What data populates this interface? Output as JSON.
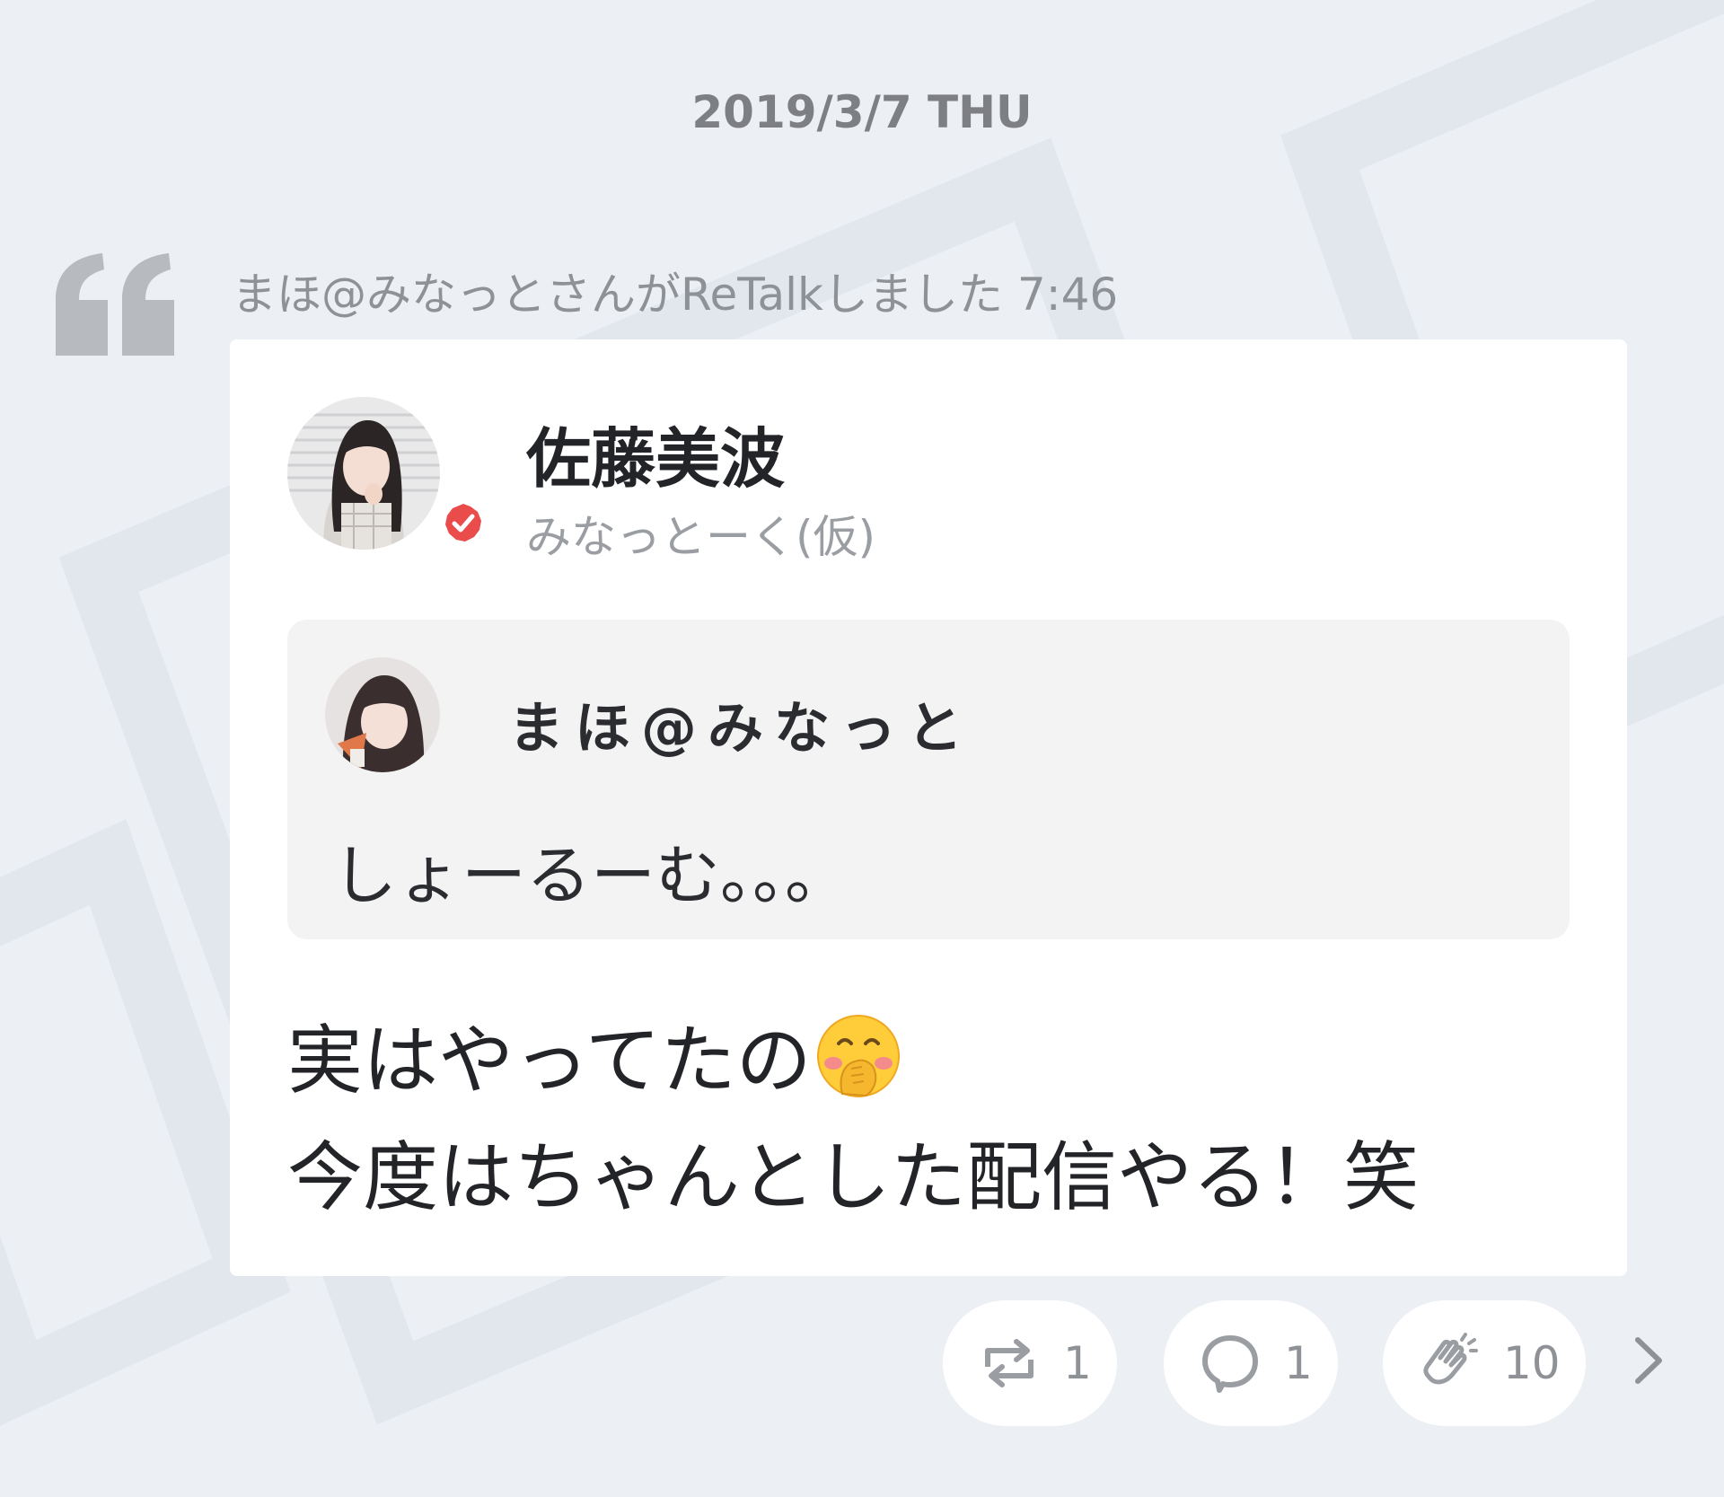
{
  "date_header": "2019/3/7 THU",
  "retalk": {
    "text": "まほ@みなっとさんがReTalkしました",
    "time": "7:46"
  },
  "post": {
    "author": "佐藤美波",
    "community": "みなっとーく(仮)",
    "verified": true,
    "quoted": {
      "author": "まほ@みなっと",
      "text": "しょーるーむ。。。"
    },
    "body_line1": "実はやってたの",
    "body_line1_emoji": "face-with-hand-over-mouth",
    "body_line2": "今度はちゃんとした配信やる！笑"
  },
  "actions": {
    "retalk_count": "1",
    "comment_count": "1",
    "clap_count": "10"
  },
  "colors": {
    "background": "#eceff3",
    "verified_badge": "#ea4b4b",
    "card": "#ffffff",
    "quoted_card": "#f3f3f4"
  }
}
